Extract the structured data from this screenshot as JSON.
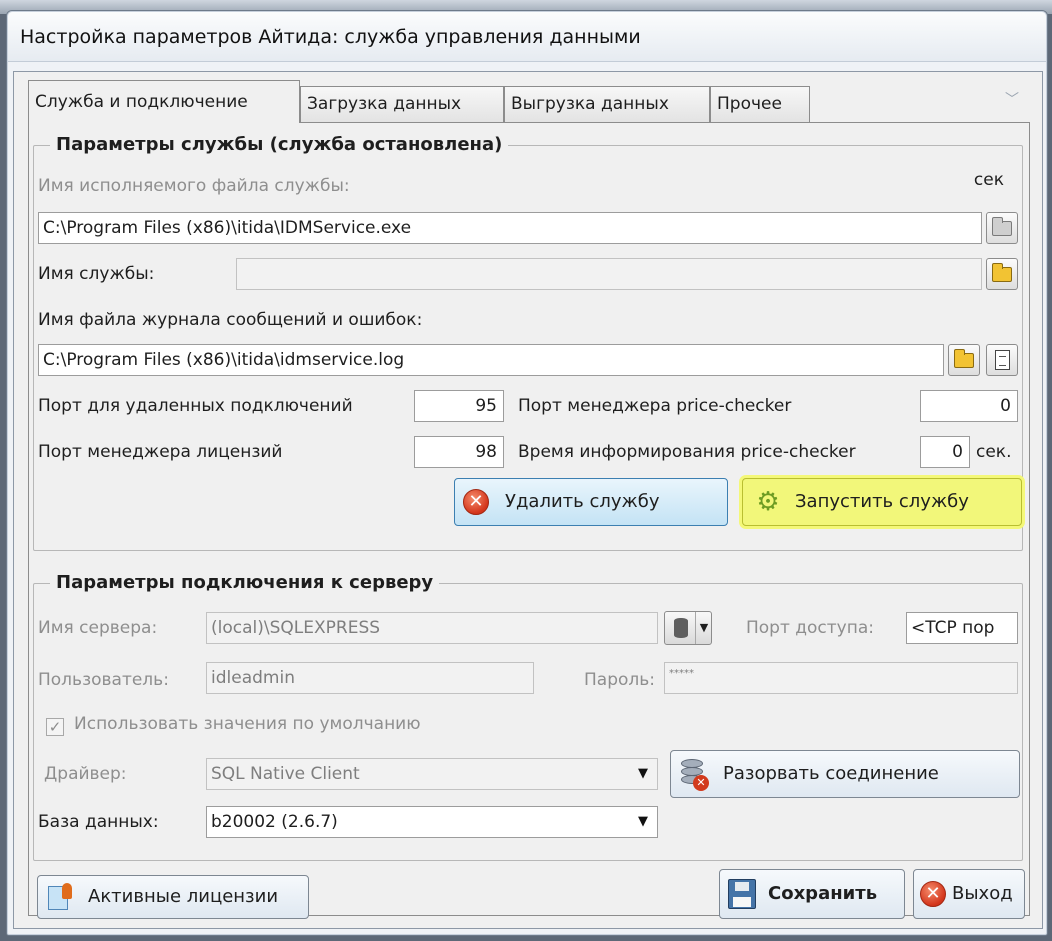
{
  "window": {
    "title": "Настройка параметров Айтида: служба управления данными"
  },
  "tabs": [
    {
      "label": "Служба и подключение",
      "active": true
    },
    {
      "label": "Загрузка данных",
      "active": false
    },
    {
      "label": "Выгрузка данных",
      "active": false
    },
    {
      "label": "Прочее",
      "active": false
    }
  ],
  "service": {
    "group_title": "Параметры службы (служба остановлена)",
    "exe_label": "Имя исполняемого файла службы:",
    "exe_unit": "сек",
    "exe_value": "C:\\Program Files (x86)\\itida\\IDMService.exe",
    "name_label": "Имя службы:",
    "name_value": "",
    "log_label": "Имя файла журнала сообщений и ошибок:",
    "log_value": "C:\\Program Files (x86)\\itida\\idmservice.log",
    "remote_port_label": "Порт для удаленных подключений",
    "remote_port_value": "95",
    "pricechecker_port_label": "Порт менеджера price-checker",
    "pricechecker_port_value": "0",
    "license_port_label": "Порт менеджера лицензий",
    "license_port_value": "98",
    "inform_time_label": "Время информирования price-checker",
    "inform_time_value": "0",
    "inform_time_unit": "сек.",
    "delete_button": "Удалить службу",
    "start_button": "Запустить службу"
  },
  "connection": {
    "group_title": "Параметры подключения к серверу",
    "server_label": "Имя сервера:",
    "server_value": "(local)\\SQLEXPRESS",
    "port_label": "Порт доступа:",
    "port_value": "<TCP пор",
    "user_label": "Пользователь:",
    "user_value": "idleadmin",
    "password_label": "Пароль:",
    "password_value": "*****",
    "defaults_label": "Использовать значения по умолчанию",
    "defaults_checked": true,
    "driver_label": "Драйвер:",
    "driver_value": "SQL Native Client",
    "disconnect_button": "Разорвать соединение",
    "db_label": "База данных:",
    "db_value": "b20002 (2.6.7)"
  },
  "footer": {
    "licenses_button": "Активные лицензии",
    "save_button": "Сохранить",
    "exit_button": "Выход"
  }
}
